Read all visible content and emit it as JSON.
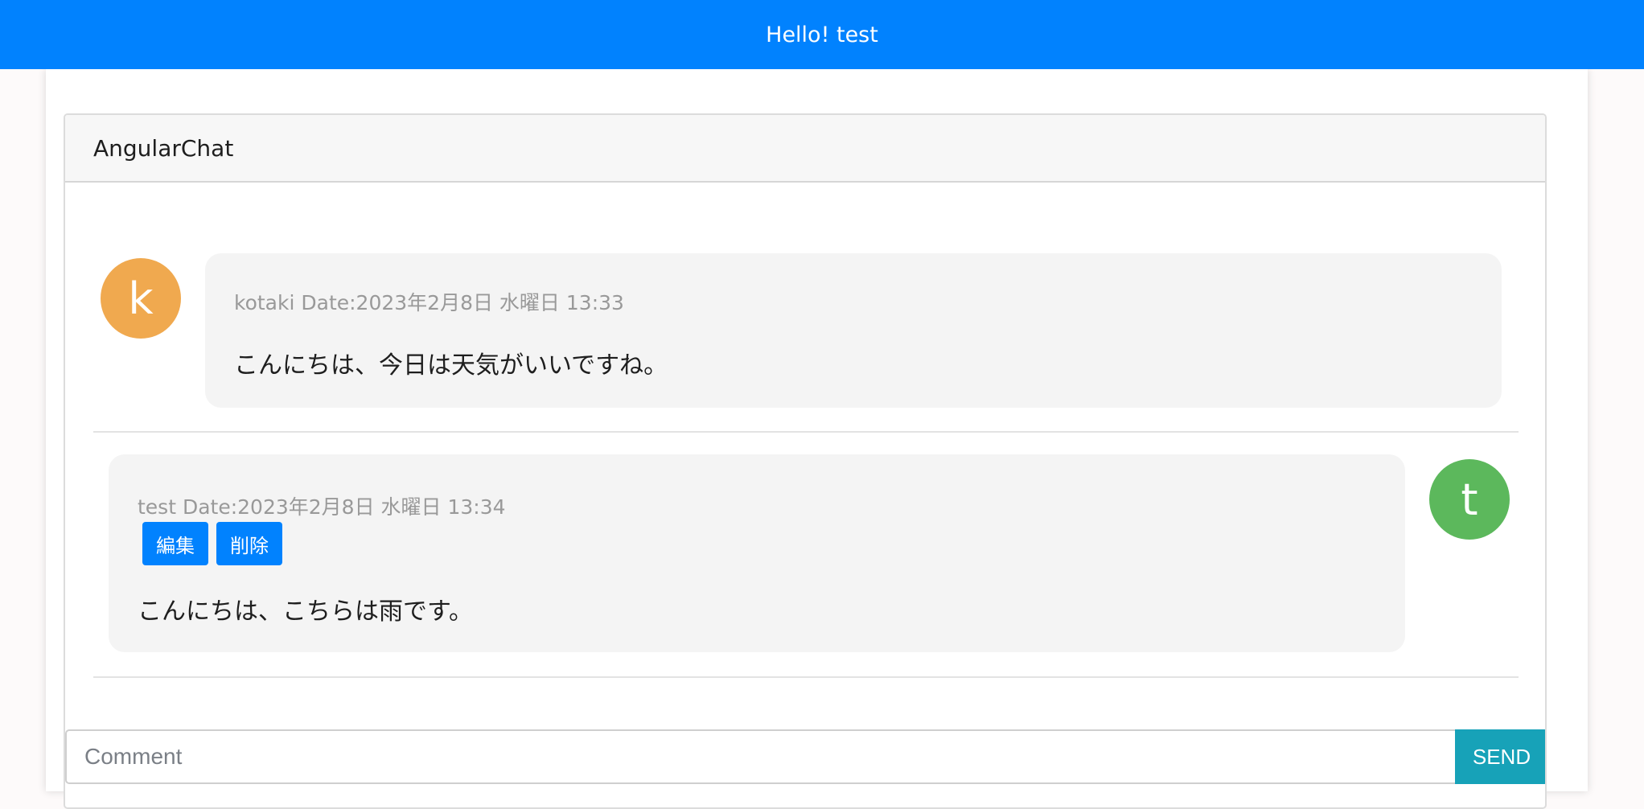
{
  "header": {
    "greeting": "Hello! test"
  },
  "chat": {
    "title": "AngularChat",
    "messages": [
      {
        "avatar_letter": "k",
        "avatar_color": "#f0a94f",
        "meta": "kotaki Date:2023年2月8日 水曜日 13:33",
        "text": "こんにちは、今日は天気がいいですね。"
      },
      {
        "avatar_letter": "t",
        "avatar_color": "#5cb85c",
        "meta": "test Date:2023年2月8日 水曜日 13:34",
        "edit_label": "編集",
        "delete_label": "削除",
        "text": "こんにちは、こちらは雨です。"
      }
    ]
  },
  "comment": {
    "placeholder": "Comment",
    "value": "",
    "send_label": "SEND"
  },
  "colors": {
    "primary": "#0182fe",
    "send": "#17a2b8"
  }
}
